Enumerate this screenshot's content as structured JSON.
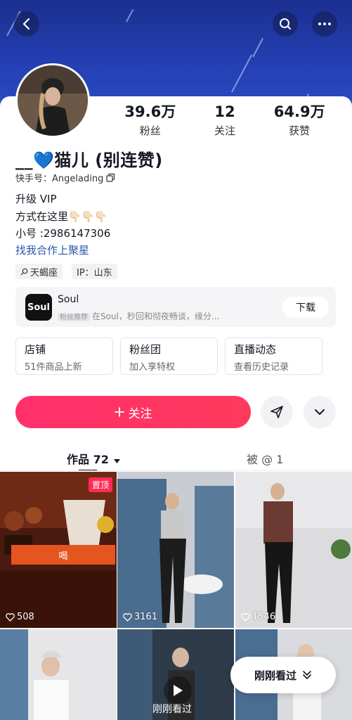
{
  "header": {
    "back_icon": "chevron-left-icon",
    "search_icon": "search-icon",
    "more_icon": "more-horizontal-icon"
  },
  "profile": {
    "nickname": "__💙猫儿 (别连赞)",
    "kuaishou_id": "快手号：Angelading",
    "stats": [
      {
        "value": "39.6万",
        "label": "粉丝"
      },
      {
        "value": "12",
        "label": "关注"
      },
      {
        "value": "64.9万",
        "label": "获赞"
      }
    ],
    "bio_lines": [
      "升级 VIP",
      "方式在这里👇🏻👇🏻👇🏻",
      "小号 :2986147306"
    ],
    "bio_link": "找我合作上聚星",
    "tags": [
      "天蝎座",
      "IP：山东"
    ]
  },
  "ad": {
    "app_name": "Soul",
    "icon_text": "Soul",
    "badge": "粉丝推荐",
    "description": "在Soul，秒回和彻夜畅谈，缘分...",
    "button": "下载"
  },
  "entries": [
    {
      "title": "店铺",
      "subtitle": "51件商品上新"
    },
    {
      "title": "粉丝团",
      "subtitle": "加入享特权"
    },
    {
      "title": "直播动态",
      "subtitle": "查看历史记录"
    }
  ],
  "actions": {
    "follow_label": "关注",
    "share_icon": "send-icon",
    "expand_icon": "chevron-down-icon"
  },
  "tabs": {
    "works": "作品 72",
    "mentioned": "被 @ 1"
  },
  "videos": [
    {
      "likes": "508",
      "pinned": "置顶",
      "caption": "喝"
    },
    {
      "likes": "3161"
    },
    {
      "likes": "1546"
    },
    {
      "overlay": "刚刚看过"
    }
  ],
  "recent_button": "刚刚看过",
  "colors": {
    "accent": "#fe2c55",
    "banner": "#2440b4",
    "link": "#2c58a8"
  }
}
